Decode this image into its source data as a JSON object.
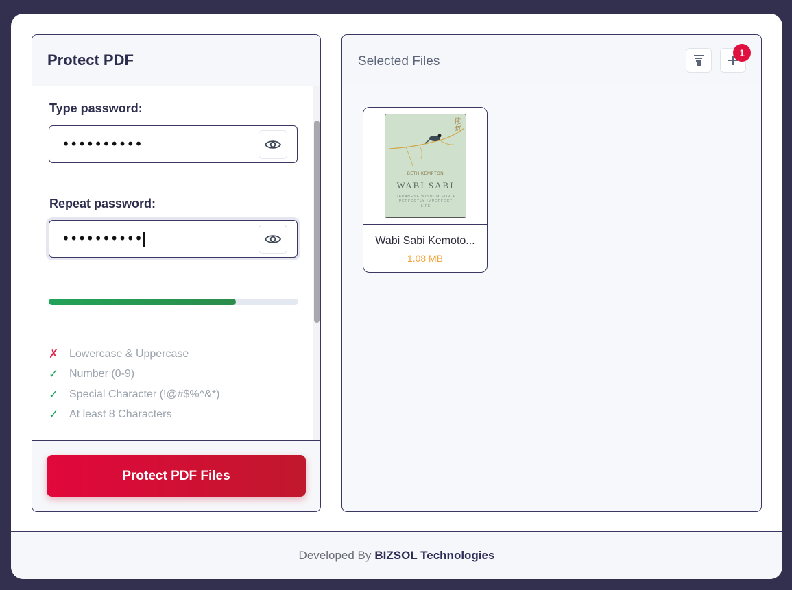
{
  "left_panel": {
    "title": "Protect PDF",
    "type_password_label": "Type password:",
    "type_password_value": "••••••••••",
    "repeat_password_label": "Repeat password:",
    "repeat_password_value": "••••••••••",
    "strength_percent": 75,
    "rules": [
      {
        "label": "Lowercase & Uppercase",
        "mark": "✗",
        "status": "fail"
      },
      {
        "label": "Number (0-9)",
        "mark": "✓",
        "status": "pass"
      },
      {
        "label": "Special Character (!@#$%^&*)",
        "mark": "✓",
        "status": "pass"
      },
      {
        "label": "At least 8 Characters",
        "mark": "✓",
        "status": "pass"
      }
    ],
    "submit_label": "Protect PDF Files"
  },
  "right_panel": {
    "title": "Selected Files",
    "sort_icon": "sort-icon",
    "add_icon": "plus-icon",
    "badge_count": "1",
    "files": [
      {
        "name": "Wabi Sabi Kemoto...",
        "size": "1.08 MB",
        "cover": {
          "author": "BETH KEMPTON",
          "title": "WABI SABI",
          "subtitle": "JAPANESE WISDOM FOR A PERFECTLY IMPERFECT LIFE",
          "kanji": "侘寂"
        }
      }
    ]
  },
  "footer": {
    "prefix": "Developed By",
    "brand": "BIZSOL Technologies"
  },
  "colors": {
    "accent": "#e2073c",
    "strength": "#22a358",
    "pass": "#1ea05b",
    "fail": "#e0224a",
    "file_size": "#f2a43a",
    "border": "#3a3862"
  }
}
